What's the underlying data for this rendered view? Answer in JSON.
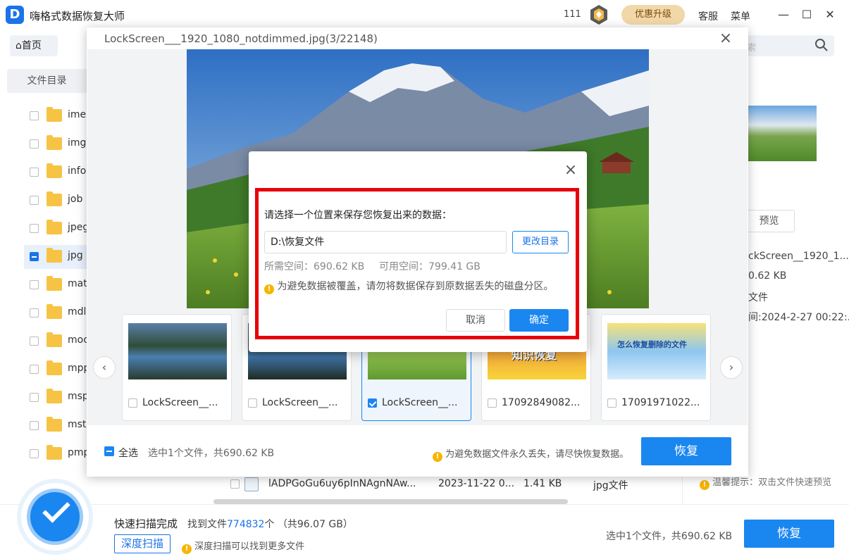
{
  "app": {
    "title": "嗨格式数据恢复大师",
    "count": "111",
    "upgrade_label": "优惠升级",
    "service_label": "客服",
    "menu_label": "菜单"
  },
  "nav": {
    "home_label": "首页",
    "search_placeholder": "索"
  },
  "sidebar": {
    "header": "文件目录",
    "items": [
      {
        "label": "ime"
      },
      {
        "label": "img"
      },
      {
        "label": "info"
      },
      {
        "label": "job"
      },
      {
        "label": "jpeg"
      },
      {
        "label": "jpg"
      },
      {
        "label": "mat"
      },
      {
        "label": "mdl"
      },
      {
        "label": "moc"
      },
      {
        "label": "mpp"
      },
      {
        "label": "msp"
      },
      {
        "label": "mst"
      },
      {
        "label": "pmp"
      }
    ]
  },
  "right_panel": {
    "preview_label": "预览",
    "name": "ckScreen__1920_1...",
    "size": "0.62 KB",
    "type": "文件",
    "date": "间:2024-2-27 00:22:...",
    "tip": "温馨提示：双击文件快速预览"
  },
  "file_row": {
    "name": "lADPGoGu6uy6pInNAgnNAw...",
    "date": "2023-11-22 0...",
    "size": "1.41 KB",
    "type": "jpg文件"
  },
  "bottom": {
    "scan_done": "快速扫描完成",
    "found_prefix": "找到文件",
    "found_count": "774832",
    "found_suffix": "个 （共96.07 GB）",
    "deep_scan": "深度扫描",
    "deep_tip": "深度扫描可以找到更多文件",
    "selection": "选中1个文件，共690.62 KB",
    "recover": "恢复"
  },
  "preview_dialog": {
    "title": "LockScreen___1920_1080_notdimmed.jpg(3/22148)",
    "thumbs": [
      {
        "name": "LockScreen__...",
        "checked": false
      },
      {
        "name": "LockScreen__...",
        "checked": false
      },
      {
        "name": "LockScreen__...",
        "checked": true
      },
      {
        "name": "17092849082...",
        "checked": false
      },
      {
        "name": "17091971022...",
        "checked": false
      }
    ],
    "select_all": "全选",
    "selection_info": "选中1个文件，共690.62 KB",
    "warning": "为避免数据文件永久丢失，请尽快恢复数据。",
    "recover": "恢复",
    "thumb4_text": "知识恢复",
    "thumb5_text": "怎么恢复删除的文件"
  },
  "save_dialog": {
    "prompt": "请选择一个位置来保存您恢复出来的数据：",
    "path": "D:\\恢复文件",
    "change_dir": "更改目录",
    "need_space": "所需空间：690.62 KB",
    "free_space": "可用空间：799.41 GB",
    "warning": "为避免数据被覆盖，请勿将数据保存到原数据丢失的磁盘分区。",
    "cancel": "取消",
    "ok": "确定"
  },
  "colors": {
    "accent": "#1a86f0",
    "highlight": "#e8000a",
    "upgrade_bg": "#f2d8a8"
  }
}
